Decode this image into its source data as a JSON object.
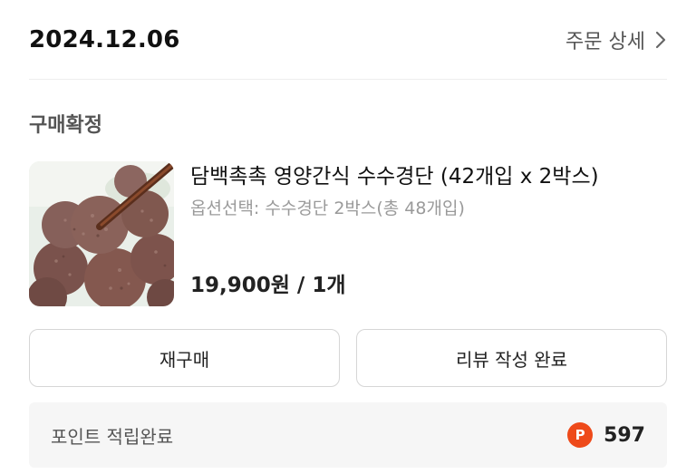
{
  "header": {
    "order_date": "2024.12.06",
    "detail_label": "주문 상세",
    "detail_icon": "chevron-right-icon"
  },
  "status": {
    "label": "구매확정"
  },
  "product": {
    "name": "담백촉촉 영양간식 수수경단 (42개입 x 2박스)",
    "option": "옵션선택: 수수경단 2박스(총 48개입)",
    "price": "19,900원 / 1개",
    "image": "product-thumbnail-image"
  },
  "actions": {
    "rebuy_label": "재구매",
    "review_label": "리뷰 작성 완료"
  },
  "points": {
    "label": "포인트 적립완료",
    "icon_letter": "P",
    "value": "597",
    "icon_color": "#ee4a1a"
  }
}
